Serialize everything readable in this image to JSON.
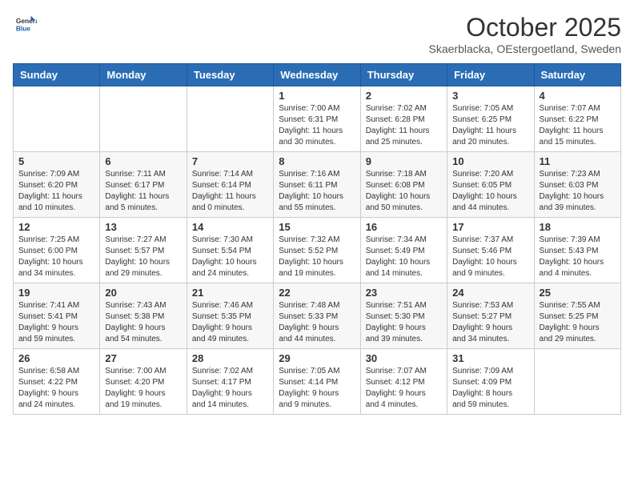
{
  "header": {
    "logo": {
      "general": "General",
      "blue": "Blue"
    },
    "title": "October 2025",
    "subtitle": "Skaerblacka, OEstergoetland, Sweden"
  },
  "weekdays": [
    "Sunday",
    "Monday",
    "Tuesday",
    "Wednesday",
    "Thursday",
    "Friday",
    "Saturday"
  ],
  "weeks": [
    [
      {
        "day": "",
        "info": ""
      },
      {
        "day": "",
        "info": ""
      },
      {
        "day": "",
        "info": ""
      },
      {
        "day": "1",
        "info": "Sunrise: 7:00 AM\nSunset: 6:31 PM\nDaylight: 11 hours\nand 30 minutes."
      },
      {
        "day": "2",
        "info": "Sunrise: 7:02 AM\nSunset: 6:28 PM\nDaylight: 11 hours\nand 25 minutes."
      },
      {
        "day": "3",
        "info": "Sunrise: 7:05 AM\nSunset: 6:25 PM\nDaylight: 11 hours\nand 20 minutes."
      },
      {
        "day": "4",
        "info": "Sunrise: 7:07 AM\nSunset: 6:22 PM\nDaylight: 11 hours\nand 15 minutes."
      }
    ],
    [
      {
        "day": "5",
        "info": "Sunrise: 7:09 AM\nSunset: 6:20 PM\nDaylight: 11 hours\nand 10 minutes."
      },
      {
        "day": "6",
        "info": "Sunrise: 7:11 AM\nSunset: 6:17 PM\nDaylight: 11 hours\nand 5 minutes."
      },
      {
        "day": "7",
        "info": "Sunrise: 7:14 AM\nSunset: 6:14 PM\nDaylight: 11 hours\nand 0 minutes."
      },
      {
        "day": "8",
        "info": "Sunrise: 7:16 AM\nSunset: 6:11 PM\nDaylight: 10 hours\nand 55 minutes."
      },
      {
        "day": "9",
        "info": "Sunrise: 7:18 AM\nSunset: 6:08 PM\nDaylight: 10 hours\nand 50 minutes."
      },
      {
        "day": "10",
        "info": "Sunrise: 7:20 AM\nSunset: 6:05 PM\nDaylight: 10 hours\nand 44 minutes."
      },
      {
        "day": "11",
        "info": "Sunrise: 7:23 AM\nSunset: 6:03 PM\nDaylight: 10 hours\nand 39 minutes."
      }
    ],
    [
      {
        "day": "12",
        "info": "Sunrise: 7:25 AM\nSunset: 6:00 PM\nDaylight: 10 hours\nand 34 minutes."
      },
      {
        "day": "13",
        "info": "Sunrise: 7:27 AM\nSunset: 5:57 PM\nDaylight: 10 hours\nand 29 minutes."
      },
      {
        "day": "14",
        "info": "Sunrise: 7:30 AM\nSunset: 5:54 PM\nDaylight: 10 hours\nand 24 minutes."
      },
      {
        "day": "15",
        "info": "Sunrise: 7:32 AM\nSunset: 5:52 PM\nDaylight: 10 hours\nand 19 minutes."
      },
      {
        "day": "16",
        "info": "Sunrise: 7:34 AM\nSunset: 5:49 PM\nDaylight: 10 hours\nand 14 minutes."
      },
      {
        "day": "17",
        "info": "Sunrise: 7:37 AM\nSunset: 5:46 PM\nDaylight: 10 hours\nand 9 minutes."
      },
      {
        "day": "18",
        "info": "Sunrise: 7:39 AM\nSunset: 5:43 PM\nDaylight: 10 hours\nand 4 minutes."
      }
    ],
    [
      {
        "day": "19",
        "info": "Sunrise: 7:41 AM\nSunset: 5:41 PM\nDaylight: 9 hours\nand 59 minutes."
      },
      {
        "day": "20",
        "info": "Sunrise: 7:43 AM\nSunset: 5:38 PM\nDaylight: 9 hours\nand 54 minutes."
      },
      {
        "day": "21",
        "info": "Sunrise: 7:46 AM\nSunset: 5:35 PM\nDaylight: 9 hours\nand 49 minutes."
      },
      {
        "day": "22",
        "info": "Sunrise: 7:48 AM\nSunset: 5:33 PM\nDaylight: 9 hours\nand 44 minutes."
      },
      {
        "day": "23",
        "info": "Sunrise: 7:51 AM\nSunset: 5:30 PM\nDaylight: 9 hours\nand 39 minutes."
      },
      {
        "day": "24",
        "info": "Sunrise: 7:53 AM\nSunset: 5:27 PM\nDaylight: 9 hours\nand 34 minutes."
      },
      {
        "day": "25",
        "info": "Sunrise: 7:55 AM\nSunset: 5:25 PM\nDaylight: 9 hours\nand 29 minutes."
      }
    ],
    [
      {
        "day": "26",
        "info": "Sunrise: 6:58 AM\nSunset: 4:22 PM\nDaylight: 9 hours\nand 24 minutes."
      },
      {
        "day": "27",
        "info": "Sunrise: 7:00 AM\nSunset: 4:20 PM\nDaylight: 9 hours\nand 19 minutes."
      },
      {
        "day": "28",
        "info": "Sunrise: 7:02 AM\nSunset: 4:17 PM\nDaylight: 9 hours\nand 14 minutes."
      },
      {
        "day": "29",
        "info": "Sunrise: 7:05 AM\nSunset: 4:14 PM\nDaylight: 9 hours\nand 9 minutes."
      },
      {
        "day": "30",
        "info": "Sunrise: 7:07 AM\nSunset: 4:12 PM\nDaylight: 9 hours\nand 4 minutes."
      },
      {
        "day": "31",
        "info": "Sunrise: 7:09 AM\nSunset: 4:09 PM\nDaylight: 8 hours\nand 59 minutes."
      },
      {
        "day": "",
        "info": ""
      }
    ]
  ]
}
